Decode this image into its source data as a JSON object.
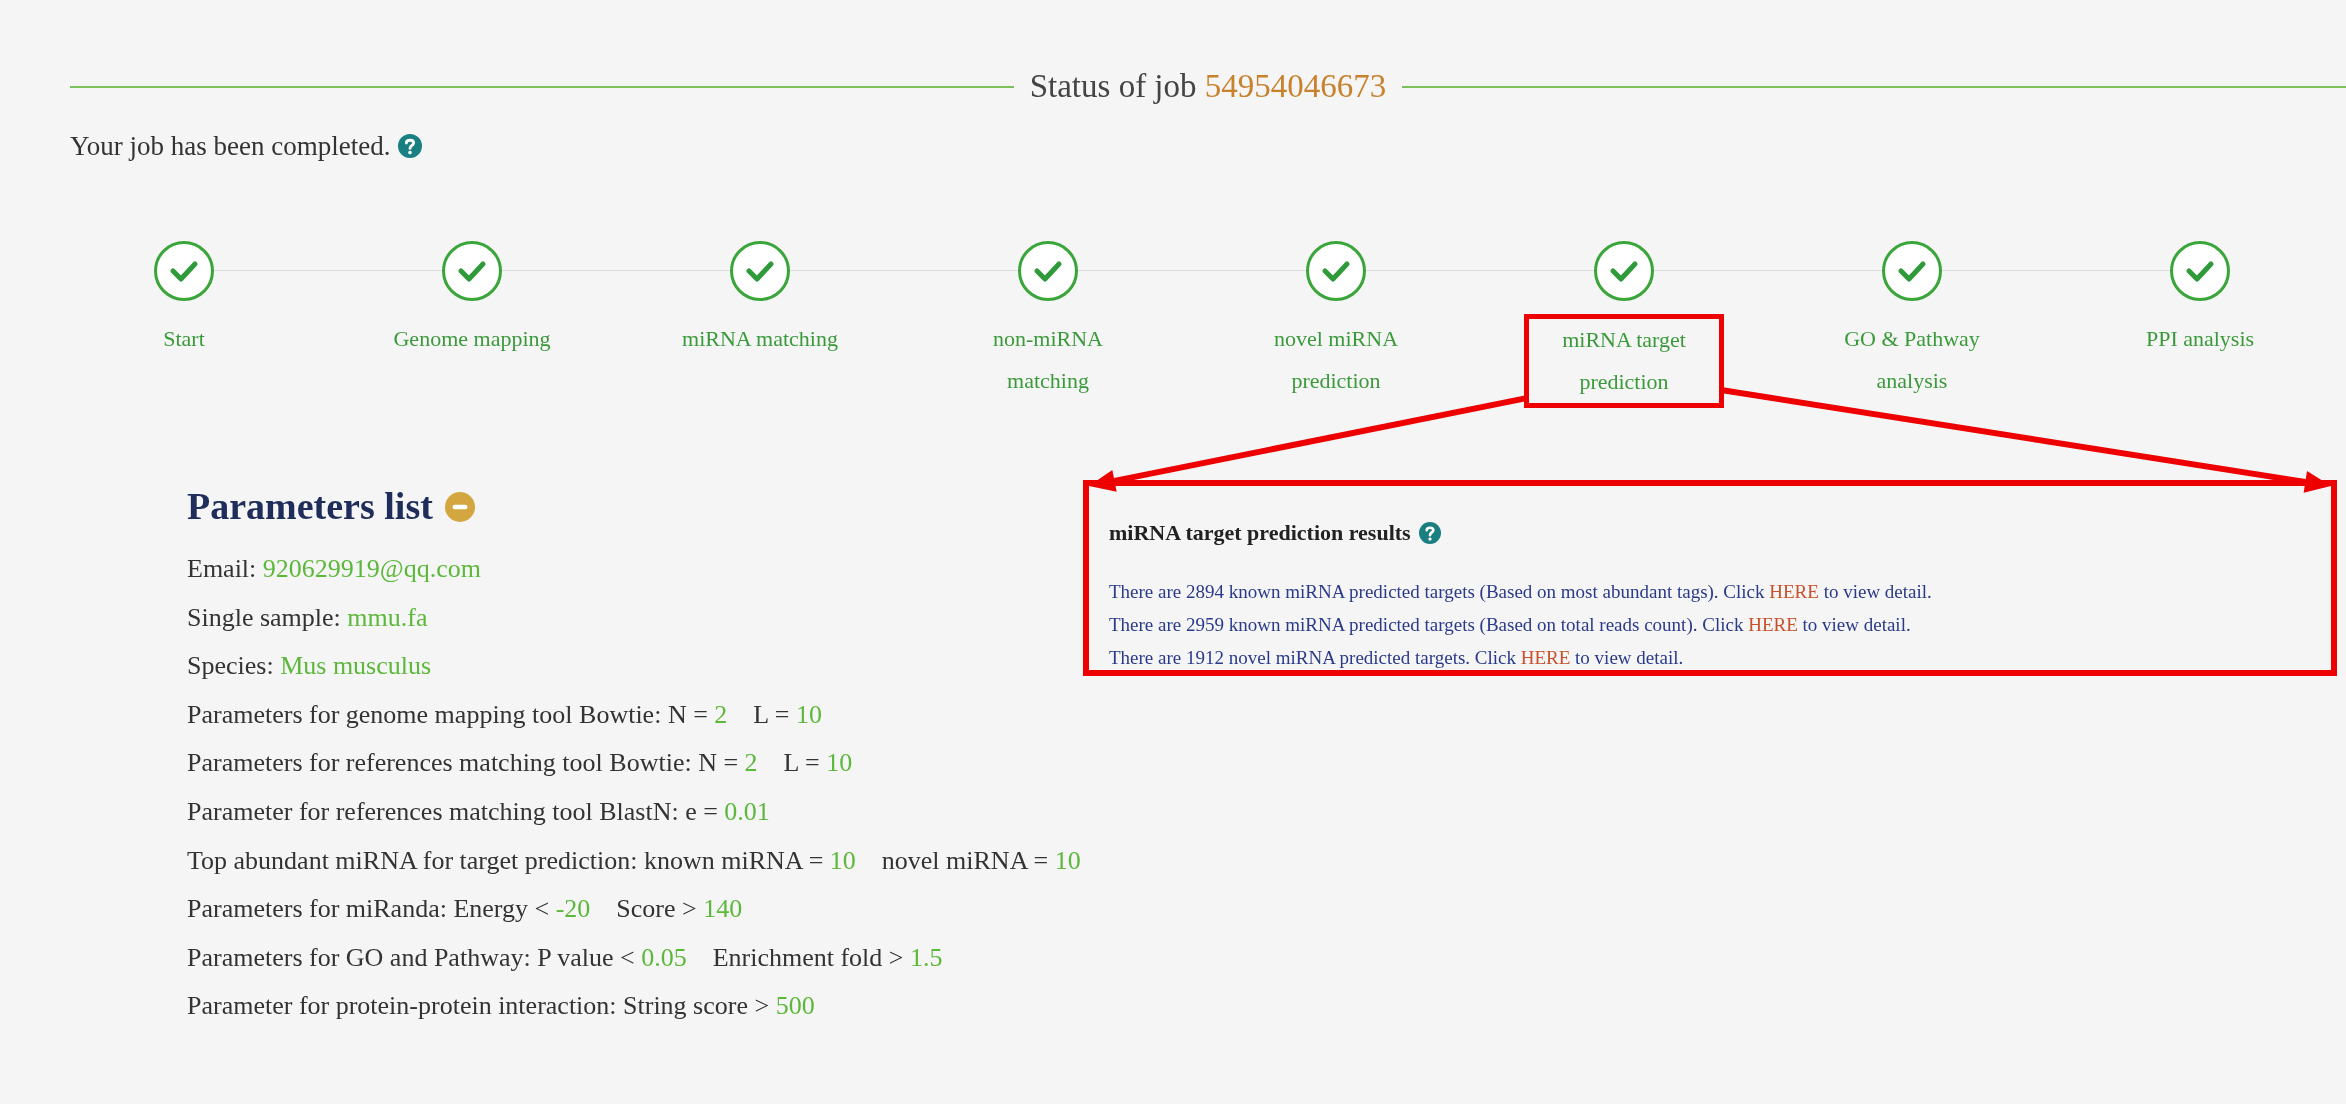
{
  "title": {
    "label": "Status of job",
    "job_id": "54954046673"
  },
  "status_message": "Your job has been completed.",
  "steps": [
    {
      "label": "Start",
      "done": true,
      "highlighted": false
    },
    {
      "label": "Genome mapping",
      "done": true,
      "highlighted": false
    },
    {
      "label": "miRNA matching",
      "done": true,
      "highlighted": false
    },
    {
      "label": "non-miRNA matching",
      "done": true,
      "highlighted": false
    },
    {
      "label": "novel miRNA prediction",
      "done": true,
      "highlighted": false
    },
    {
      "label": "miRNA target prediction",
      "done": true,
      "highlighted": true
    },
    {
      "label": "GO & Pathway analysis",
      "done": true,
      "highlighted": false
    },
    {
      "label": "PPI analysis",
      "done": true,
      "highlighted": false
    }
  ],
  "parameters": {
    "heading": "Parameters list",
    "expanded": true,
    "items": [
      [
        {
          "kind": "label",
          "text": "Email:"
        },
        {
          "kind": "value",
          "text": "920629919@qq.com"
        }
      ],
      [
        {
          "kind": "label",
          "text": "Single sample:"
        },
        {
          "kind": "value",
          "text": "mmu.fa"
        }
      ],
      [
        {
          "kind": "label",
          "text": "Species:"
        },
        {
          "kind": "value",
          "text": "Mus musculus"
        }
      ],
      [
        {
          "kind": "label",
          "text": "Parameters for genome mapping tool Bowtie: N ="
        },
        {
          "kind": "value",
          "text": "2"
        },
        {
          "kind": "label",
          "text": "L ="
        },
        {
          "kind": "value",
          "text": "10"
        }
      ],
      [
        {
          "kind": "label",
          "text": "Parameters for references matching tool Bowtie: N ="
        },
        {
          "kind": "value",
          "text": "2"
        },
        {
          "kind": "label",
          "text": "L ="
        },
        {
          "kind": "value",
          "text": "10"
        }
      ],
      [
        {
          "kind": "label",
          "text": "Parameter for references matching tool BlastN: e ="
        },
        {
          "kind": "value",
          "text": "0.01"
        }
      ],
      [
        {
          "kind": "label",
          "text": "Top abundant miRNA for target prediction: known miRNA ="
        },
        {
          "kind": "value",
          "text": "10"
        },
        {
          "kind": "label",
          "text": "novel miRNA ="
        },
        {
          "kind": "value",
          "text": "10"
        }
      ],
      [
        {
          "kind": "label",
          "text": "Parameters for miRanda: Energy <"
        },
        {
          "kind": "value",
          "text": "-20"
        },
        {
          "kind": "label",
          "text": "Score >"
        },
        {
          "kind": "value",
          "text": "140"
        }
      ],
      [
        {
          "kind": "label",
          "text": "Parameters for GO and Pathway: P value <"
        },
        {
          "kind": "value",
          "text": "0.05"
        },
        {
          "kind": "label",
          "text": "Enrichment fold >"
        },
        {
          "kind": "value",
          "text": "1.5"
        }
      ],
      [
        {
          "kind": "label",
          "text": "Parameter for protein-protein interaction: String score >"
        },
        {
          "kind": "value",
          "text": "500"
        }
      ]
    ]
  },
  "results": {
    "title": "miRNA target prediction results",
    "lines": [
      {
        "before": "There are 2894 known miRNA predicted targets (Based on most abundant tags). Click",
        "link": "HERE",
        "after": "to view detail."
      },
      {
        "before": "There are 2959 known miRNA predicted targets (Based on total reads count). Click",
        "link": "HERE",
        "after": "to view detail."
      },
      {
        "before": "There are 1912 novel miRNA predicted targets. Click",
        "link": "HERE",
        "after": "to view detail."
      }
    ]
  }
}
